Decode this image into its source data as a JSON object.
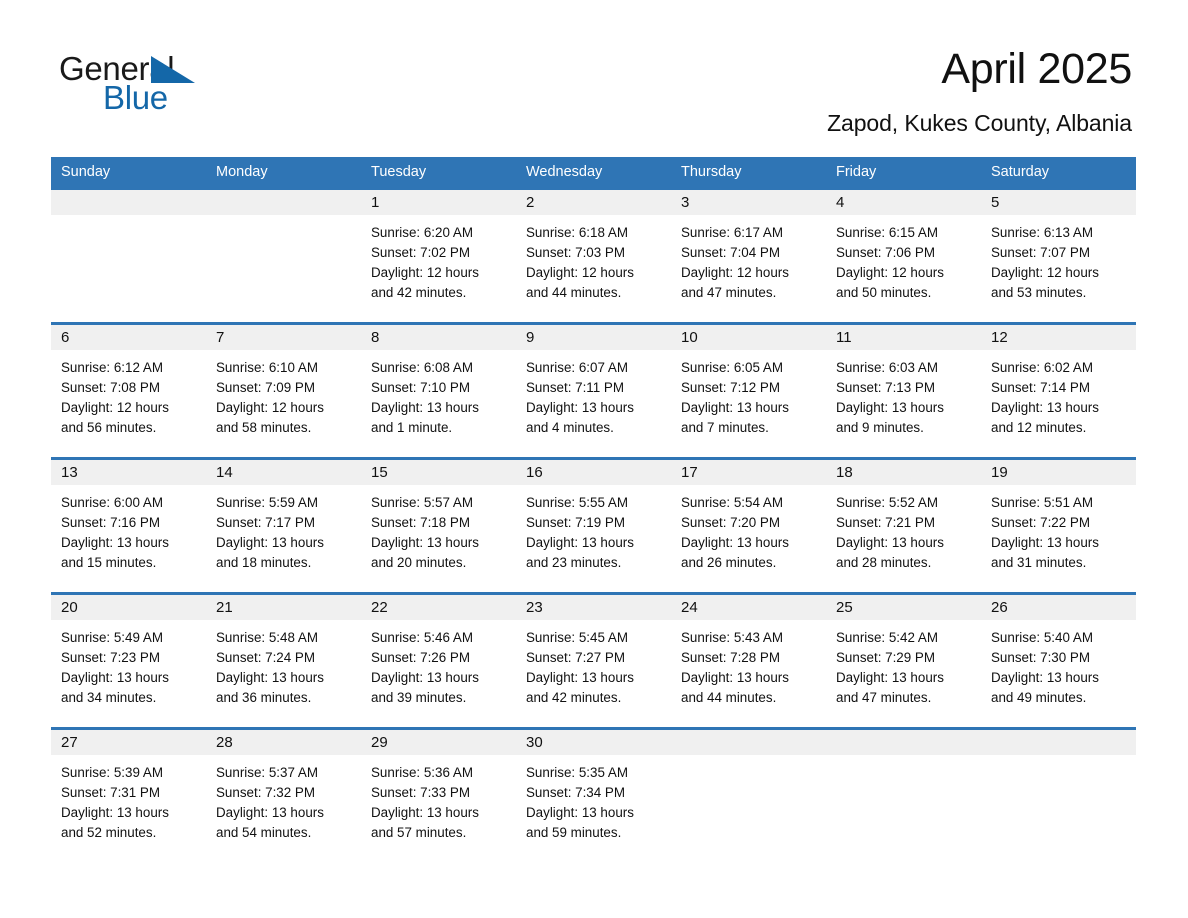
{
  "logo": {
    "word_one": "General",
    "word_two": "Blue",
    "triangle_icon": "triangle-icon",
    "brand_color": "#1467a8"
  },
  "header": {
    "month_title": "April 2025",
    "location": "Zapod, Kukes County, Albania"
  },
  "theme": {
    "header_blue": "#2f75b5",
    "day_band_gray": "#f0f0f0",
    "text_color": "#111111"
  },
  "calendar": {
    "day_names": [
      "Sunday",
      "Monday",
      "Tuesday",
      "Wednesday",
      "Thursday",
      "Friday",
      "Saturday"
    ],
    "weeks": [
      {
        "days": [
          {
            "date": "",
            "sunrise": "",
            "sunset": "",
            "daylight_a": "",
            "daylight_b": ""
          },
          {
            "date": "",
            "sunrise": "",
            "sunset": "",
            "daylight_a": "",
            "daylight_b": ""
          },
          {
            "date": "1",
            "sunrise": "Sunrise: 6:20 AM",
            "sunset": "Sunset: 7:02 PM",
            "daylight_a": "Daylight: 12 hours",
            "daylight_b": "and 42 minutes."
          },
          {
            "date": "2",
            "sunrise": "Sunrise: 6:18 AM",
            "sunset": "Sunset: 7:03 PM",
            "daylight_a": "Daylight: 12 hours",
            "daylight_b": "and 44 minutes."
          },
          {
            "date": "3",
            "sunrise": "Sunrise: 6:17 AM",
            "sunset": "Sunset: 7:04 PM",
            "daylight_a": "Daylight: 12 hours",
            "daylight_b": "and 47 minutes."
          },
          {
            "date": "4",
            "sunrise": "Sunrise: 6:15 AM",
            "sunset": "Sunset: 7:06 PM",
            "daylight_a": "Daylight: 12 hours",
            "daylight_b": "and 50 minutes."
          },
          {
            "date": "5",
            "sunrise": "Sunrise: 6:13 AM",
            "sunset": "Sunset: 7:07 PM",
            "daylight_a": "Daylight: 12 hours",
            "daylight_b": "and 53 minutes."
          }
        ]
      },
      {
        "days": [
          {
            "date": "6",
            "sunrise": "Sunrise: 6:12 AM",
            "sunset": "Sunset: 7:08 PM",
            "daylight_a": "Daylight: 12 hours",
            "daylight_b": "and 56 minutes."
          },
          {
            "date": "7",
            "sunrise": "Sunrise: 6:10 AM",
            "sunset": "Sunset: 7:09 PM",
            "daylight_a": "Daylight: 12 hours",
            "daylight_b": "and 58 minutes."
          },
          {
            "date": "8",
            "sunrise": "Sunrise: 6:08 AM",
            "sunset": "Sunset: 7:10 PM",
            "daylight_a": "Daylight: 13 hours",
            "daylight_b": "and 1 minute."
          },
          {
            "date": "9",
            "sunrise": "Sunrise: 6:07 AM",
            "sunset": "Sunset: 7:11 PM",
            "daylight_a": "Daylight: 13 hours",
            "daylight_b": "and 4 minutes."
          },
          {
            "date": "10",
            "sunrise": "Sunrise: 6:05 AM",
            "sunset": "Sunset: 7:12 PM",
            "daylight_a": "Daylight: 13 hours",
            "daylight_b": "and 7 minutes."
          },
          {
            "date": "11",
            "sunrise": "Sunrise: 6:03 AM",
            "sunset": "Sunset: 7:13 PM",
            "daylight_a": "Daylight: 13 hours",
            "daylight_b": "and 9 minutes."
          },
          {
            "date": "12",
            "sunrise": "Sunrise: 6:02 AM",
            "sunset": "Sunset: 7:14 PM",
            "daylight_a": "Daylight: 13 hours",
            "daylight_b": "and 12 minutes."
          }
        ]
      },
      {
        "days": [
          {
            "date": "13",
            "sunrise": "Sunrise: 6:00 AM",
            "sunset": "Sunset: 7:16 PM",
            "daylight_a": "Daylight: 13 hours",
            "daylight_b": "and 15 minutes."
          },
          {
            "date": "14",
            "sunrise": "Sunrise: 5:59 AM",
            "sunset": "Sunset: 7:17 PM",
            "daylight_a": "Daylight: 13 hours",
            "daylight_b": "and 18 minutes."
          },
          {
            "date": "15",
            "sunrise": "Sunrise: 5:57 AM",
            "sunset": "Sunset: 7:18 PM",
            "daylight_a": "Daylight: 13 hours",
            "daylight_b": "and 20 minutes."
          },
          {
            "date": "16",
            "sunrise": "Sunrise: 5:55 AM",
            "sunset": "Sunset: 7:19 PM",
            "daylight_a": "Daylight: 13 hours",
            "daylight_b": "and 23 minutes."
          },
          {
            "date": "17",
            "sunrise": "Sunrise: 5:54 AM",
            "sunset": "Sunset: 7:20 PM",
            "daylight_a": "Daylight: 13 hours",
            "daylight_b": "and 26 minutes."
          },
          {
            "date": "18",
            "sunrise": "Sunrise: 5:52 AM",
            "sunset": "Sunset: 7:21 PM",
            "daylight_a": "Daylight: 13 hours",
            "daylight_b": "and 28 minutes."
          },
          {
            "date": "19",
            "sunrise": "Sunrise: 5:51 AM",
            "sunset": "Sunset: 7:22 PM",
            "daylight_a": "Daylight: 13 hours",
            "daylight_b": "and 31 minutes."
          }
        ]
      },
      {
        "days": [
          {
            "date": "20",
            "sunrise": "Sunrise: 5:49 AM",
            "sunset": "Sunset: 7:23 PM",
            "daylight_a": "Daylight: 13 hours",
            "daylight_b": "and 34 minutes."
          },
          {
            "date": "21",
            "sunrise": "Sunrise: 5:48 AM",
            "sunset": "Sunset: 7:24 PM",
            "daylight_a": "Daylight: 13 hours",
            "daylight_b": "and 36 minutes."
          },
          {
            "date": "22",
            "sunrise": "Sunrise: 5:46 AM",
            "sunset": "Sunset: 7:26 PM",
            "daylight_a": "Daylight: 13 hours",
            "daylight_b": "and 39 minutes."
          },
          {
            "date": "23",
            "sunrise": "Sunrise: 5:45 AM",
            "sunset": "Sunset: 7:27 PM",
            "daylight_a": "Daylight: 13 hours",
            "daylight_b": "and 42 minutes."
          },
          {
            "date": "24",
            "sunrise": "Sunrise: 5:43 AM",
            "sunset": "Sunset: 7:28 PM",
            "daylight_a": "Daylight: 13 hours",
            "daylight_b": "and 44 minutes."
          },
          {
            "date": "25",
            "sunrise": "Sunrise: 5:42 AM",
            "sunset": "Sunset: 7:29 PM",
            "daylight_a": "Daylight: 13 hours",
            "daylight_b": "and 47 minutes."
          },
          {
            "date": "26",
            "sunrise": "Sunrise: 5:40 AM",
            "sunset": "Sunset: 7:30 PM",
            "daylight_a": "Daylight: 13 hours",
            "daylight_b": "and 49 minutes."
          }
        ]
      },
      {
        "days": [
          {
            "date": "27",
            "sunrise": "Sunrise: 5:39 AM",
            "sunset": "Sunset: 7:31 PM",
            "daylight_a": "Daylight: 13 hours",
            "daylight_b": "and 52 minutes."
          },
          {
            "date": "28",
            "sunrise": "Sunrise: 5:37 AM",
            "sunset": "Sunset: 7:32 PM",
            "daylight_a": "Daylight: 13 hours",
            "daylight_b": "and 54 minutes."
          },
          {
            "date": "29",
            "sunrise": "Sunrise: 5:36 AM",
            "sunset": "Sunset: 7:33 PM",
            "daylight_a": "Daylight: 13 hours",
            "daylight_b": "and 57 minutes."
          },
          {
            "date": "30",
            "sunrise": "Sunrise: 5:35 AM",
            "sunset": "Sunset: 7:34 PM",
            "daylight_a": "Daylight: 13 hours",
            "daylight_b": "and 59 minutes."
          },
          {
            "date": "",
            "sunrise": "",
            "sunset": "",
            "daylight_a": "",
            "daylight_b": ""
          },
          {
            "date": "",
            "sunrise": "",
            "sunset": "",
            "daylight_a": "",
            "daylight_b": ""
          },
          {
            "date": "",
            "sunrise": "",
            "sunset": "",
            "daylight_a": "",
            "daylight_b": ""
          }
        ]
      }
    ]
  }
}
